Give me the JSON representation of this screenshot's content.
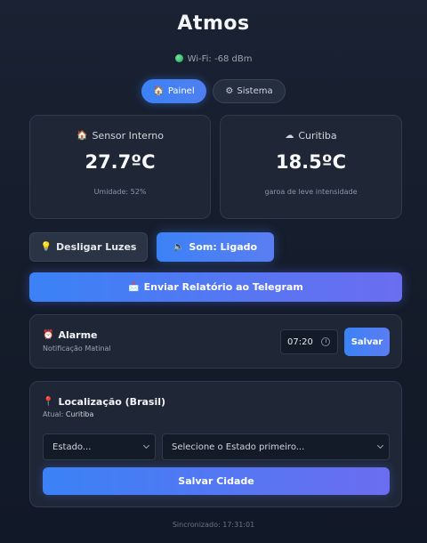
{
  "app": {
    "title": "Atmos"
  },
  "status": {
    "wifi_text": "Wi-Fi: -68 dBm"
  },
  "tabs": [
    {
      "icon": "🏠",
      "label": "Painel",
      "active": true
    },
    {
      "icon": "⚙",
      "label": "Sistema",
      "active": false
    }
  ],
  "sensor": {
    "icon": "🏠",
    "title": "Sensor Interno",
    "temperature": "27.7ºC",
    "humidity": "Umidade: 52%"
  },
  "weather": {
    "icon": "☁",
    "title": "Curitiba",
    "temperature": "18.5ºC",
    "description": "garoa de leve intensidade"
  },
  "controls": {
    "lights_icon": "💡",
    "lights_label": "Desligar Luzes",
    "sound_icon": "🔈",
    "sound_label": "Som: Ligado",
    "telegram_icon": "📩",
    "telegram_label": "Enviar Relatório ao Telegram"
  },
  "alarm": {
    "icon": "⏰",
    "title": "Alarme",
    "subtitle": "Notificação Matinal",
    "time": "07:20",
    "save_label": "Salvar"
  },
  "location": {
    "icon": "📍",
    "title": "Localização (Brasil)",
    "current_prefix": "Atual:",
    "current_city": "Curitiba",
    "state_select": "Estado...",
    "city_select": "Selecione o Estado primeiro...",
    "save_label": "Salvar Cidade"
  },
  "footer": {
    "sync_text": "Sincronizado: 17:31:01"
  },
  "colors": {
    "accent": "#3b82f6",
    "card_bg": "#1f2737",
    "page_bg": "#141b29"
  }
}
